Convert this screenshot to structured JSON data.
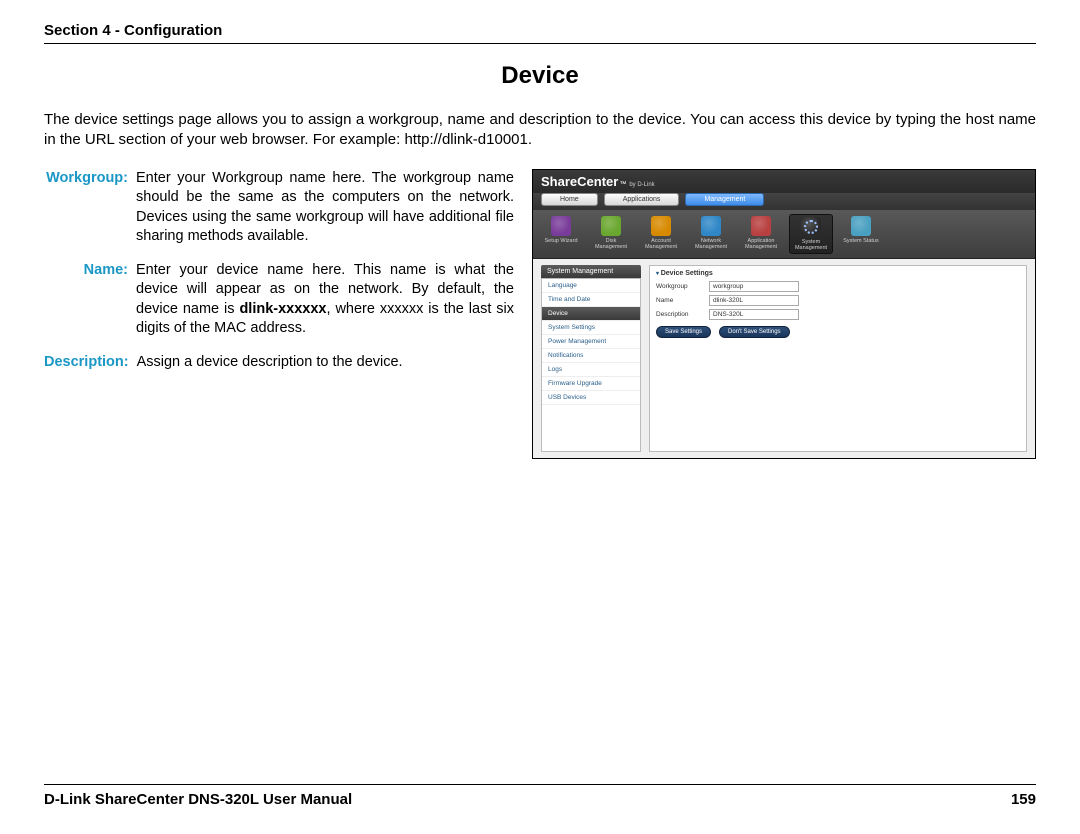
{
  "header": {
    "section": "Section 4 - Configuration"
  },
  "title": "Device",
  "intro": "The device settings page allows you to assign a workgroup, name and description to the device. You can access this device by typing the host name in the URL section of your web browser. For example: http://dlink-d10001.",
  "definitions": [
    {
      "label": "Workgroup:",
      "text": "Enter your Workgroup name here. The workgroup name should be the same as the computers on the network. Devices using the same workgroup will have additional file sharing methods available."
    },
    {
      "label": "Name:",
      "text_before": "Enter your device name here. This name is what the device will appear as on the network. By default, the device name is ",
      "bold": "dlink-xxxxxx",
      "text_after": ", where xxxxxx is the last six digits of the MAC address."
    },
    {
      "label": "Description:",
      "text": "Assign a device description to the device."
    }
  ],
  "screenshot": {
    "brand": "ShareCenter",
    "tm": "™",
    "byline": "by D-Link",
    "tabs": [
      {
        "label": "Home",
        "active": false
      },
      {
        "label": "Applications",
        "active": false
      },
      {
        "label": "Management",
        "active": true
      }
    ],
    "iconbar": [
      {
        "label": "Setup Wizard",
        "cls": "wiz"
      },
      {
        "label": "Disk Management",
        "cls": "disk"
      },
      {
        "label": "Account Management",
        "cls": "acct"
      },
      {
        "label": "Network Management",
        "cls": "net"
      },
      {
        "label": "Application Management",
        "cls": "app"
      },
      {
        "label": "System Management",
        "cls": "sys",
        "selected": true
      },
      {
        "label": "System Status",
        "cls": "stat"
      }
    ],
    "side_title": "System Management",
    "side_items": [
      {
        "label": "Language"
      },
      {
        "label": "Time and Date"
      },
      {
        "label": "Device",
        "selected": true
      },
      {
        "label": "System Settings"
      },
      {
        "label": "Power Management"
      },
      {
        "label": "Notifications"
      },
      {
        "label": "Logs"
      },
      {
        "label": "Firmware Upgrade"
      },
      {
        "label": "USB Devices"
      }
    ],
    "main_title": "Device Settings",
    "fields": [
      {
        "label": "Workgroup",
        "value": "workgroup"
      },
      {
        "label": "Name",
        "value": "dlink-320L"
      },
      {
        "label": "Description",
        "value": "DNS-320L"
      }
    ],
    "buttons": {
      "save": "Save Settings",
      "dont": "Don't Save Settings"
    }
  },
  "footer": {
    "manual": "D-Link ShareCenter DNS-320L User Manual",
    "page": "159"
  }
}
